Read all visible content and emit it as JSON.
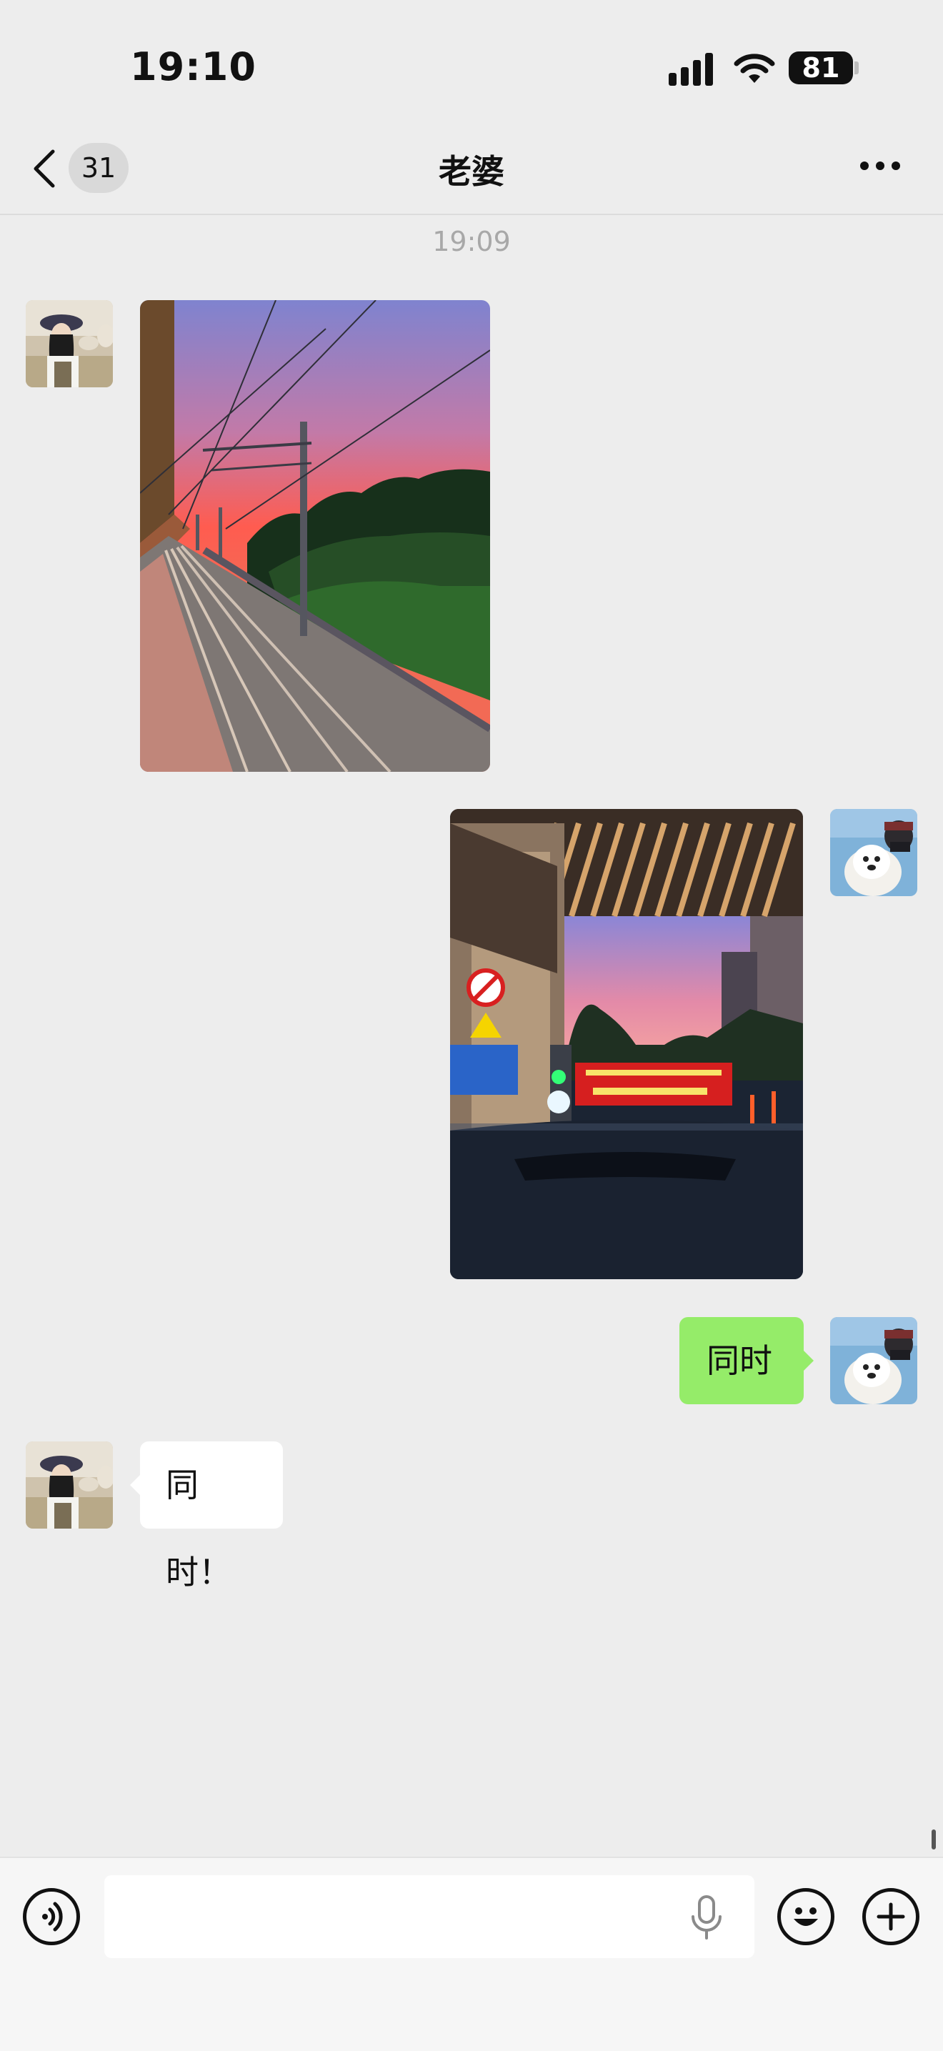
{
  "status_bar": {
    "time": "19:10",
    "battery": "81",
    "icons": [
      "signal-icon",
      "wifi-icon",
      "battery-icon"
    ]
  },
  "nav": {
    "back_icon": "chevron-left-icon",
    "unread_count": "31",
    "title": "老婆",
    "more_icon": "more-horizontal-icon"
  },
  "messages": [
    {
      "type": "timestamp",
      "text": "19:09"
    },
    {
      "type": "image",
      "direction": "incoming",
      "description": "railway-sunset-photo"
    },
    {
      "type": "image",
      "direction": "outgoing",
      "description": "car-parking-gate-sunset-photo"
    },
    {
      "type": "text",
      "direction": "outgoing",
      "text": "同时"
    },
    {
      "type": "text",
      "direction": "incoming",
      "text": "同时！"
    }
  ],
  "input_bar": {
    "voice_icon": "voice-mode-icon",
    "placeholder": "",
    "mic_icon": "microphone-icon",
    "emoji_icon": "emoji-icon",
    "plus_icon": "plus-icon"
  },
  "colors": {
    "background": "#ededed",
    "outgoing_bubble": "#95ec69",
    "incoming_bubble": "#ffffff",
    "timestamp": "#a8a8a8"
  }
}
